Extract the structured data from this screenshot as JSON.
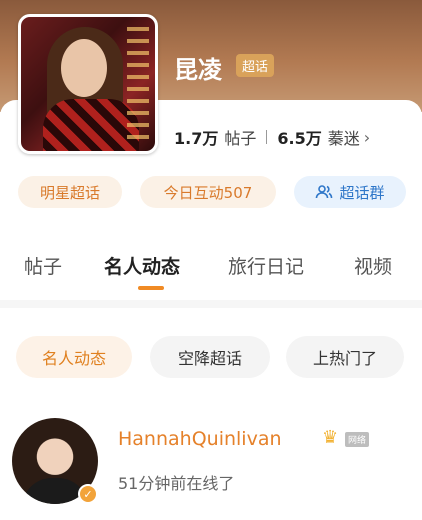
{
  "header": {
    "title": "昆凌",
    "badge": "超话",
    "stats": {
      "posts_count": "1.7万",
      "posts_label": "帖子",
      "fans_count": "6.5万",
      "fans_label": "蓁迷",
      "chevron": "›"
    }
  },
  "pills": [
    {
      "label": "明星超话"
    },
    {
      "label": "今日互动507"
    },
    {
      "label": "超话群",
      "icon": "group-icon"
    }
  ],
  "tabs": [
    {
      "label": "帖子"
    },
    {
      "label": "名人动态",
      "active": true
    },
    {
      "label": "旅行日记"
    },
    {
      "label": "视频"
    }
  ],
  "filters": [
    {
      "label": "名人动态",
      "active": true
    },
    {
      "label": "空降超话"
    },
    {
      "label": "上热门了"
    }
  ],
  "post": {
    "username": "HannahQuinlivan",
    "small_tag": "网络",
    "status": "51分钟前在线了"
  },
  "colors": {
    "accent": "#f08a24",
    "header_bg": "#a9714a",
    "badge_bg": "#d9a25a",
    "link_blue": "#2f77c9"
  }
}
